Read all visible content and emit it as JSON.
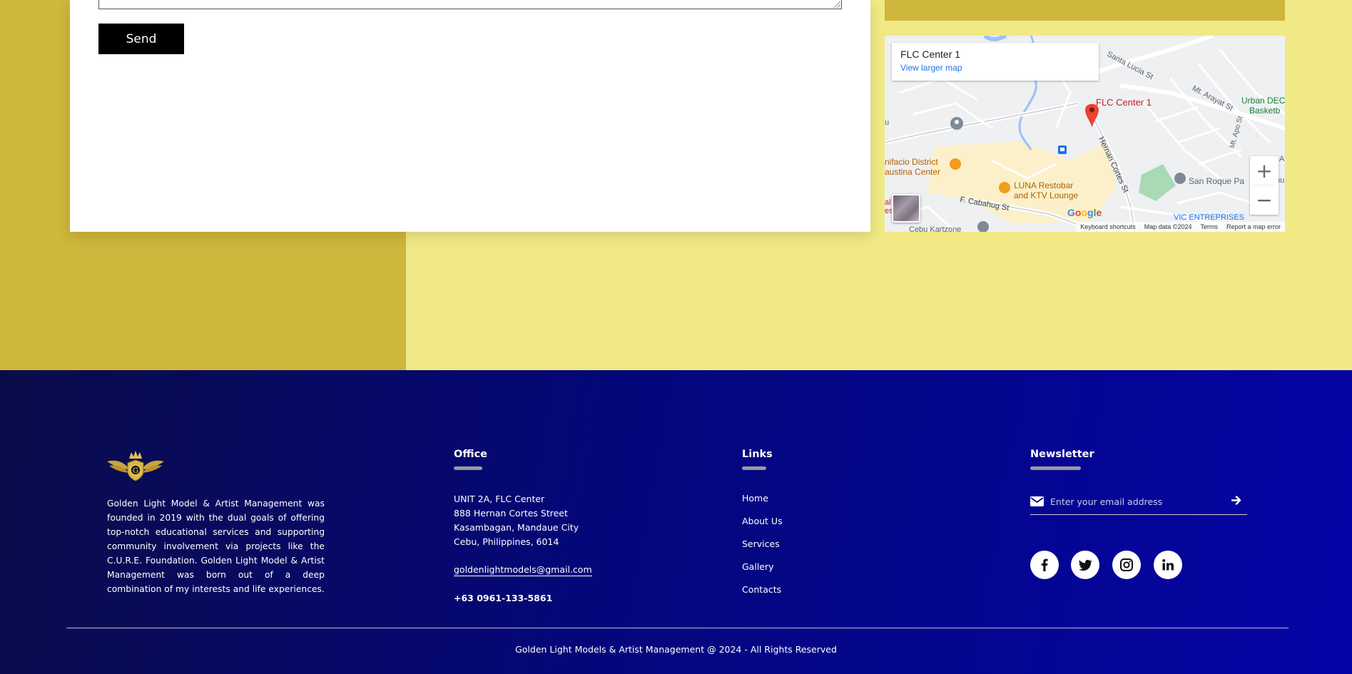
{
  "contact_form": {
    "send_label": "Send"
  },
  "map": {
    "place_name": "FLC Center 1",
    "view_larger": "View larger map",
    "pin_label": "FLC Center 1",
    "labels": {
      "santa_lucia": "Santa Lucia St",
      "arayat": "Mt. Arayat St",
      "urban": "Urban DEC",
      "basketb": "Basketb",
      "apo": "Mt. Apo St",
      "hernan": "Hernan Cortes St",
      "bonifacio_1": "nifacio District",
      "bonifacio_2": "austina Center",
      "luna_1": "LUNA Restobar",
      "luna_2": "and KTV Lounge",
      "san_roque": "San Roque Pa",
      "cabahug": "F. Cabahug St",
      "cebu_kartzone": "Cebu Kartzone",
      "vic": "VIC ENTREPRISES",
      "edge_u": "u",
      "edge_a": "A",
      "edge_al": "al",
      "edge_es": "es",
      "edge_nu": "nu"
    },
    "zoom_in": "+",
    "zoom_out": "−",
    "google": "Google",
    "footer": [
      "Keyboard shortcuts",
      "Map data ©2024",
      "Terms",
      "Report a map error"
    ],
    "colors": {
      "pin": "#ea4335",
      "poi_orange": "#f29b1d",
      "park": "#a8dab5",
      "water": "#9cc0f9"
    }
  },
  "footer": {
    "about": "Golden Light Model & Artist Management was founded in 2019 with the dual goals of offering top-notch educational services and supporting community involvement via projects like the C.U.R.E. Foundation. Golden Light Model & Artist Management was born out of a deep combination of my interests and life experiences.",
    "office": {
      "title": "Office",
      "lines": [
        "UNIT 2A, FLC Center",
        "888 Hernan Cortes Street",
        "Kasambagan, Mandaue City",
        "Cebu, Philippines, 6014"
      ],
      "email": "goldenlightmodels@gmail.com",
      "phone": "+63 0961-133-5861"
    },
    "links": {
      "title": "Links",
      "items": [
        "Home",
        "About Us",
        "Services",
        "Gallery",
        "Contacts"
      ]
    },
    "newsletter": {
      "title": "Newsletter",
      "placeholder": "Enter your email address"
    },
    "social": [
      "facebook-icon",
      "twitter-icon",
      "instagram-icon",
      "linkedin-icon"
    ],
    "copyright": "Golden Light Models & Artist Management @ 2024 - All Rights Reserved"
  },
  "colors": {
    "gold": "#cfb63c",
    "pale_yellow": "#f0e985",
    "footer_navy": "#0a0c4a",
    "footer_blue": "#0504a6"
  }
}
